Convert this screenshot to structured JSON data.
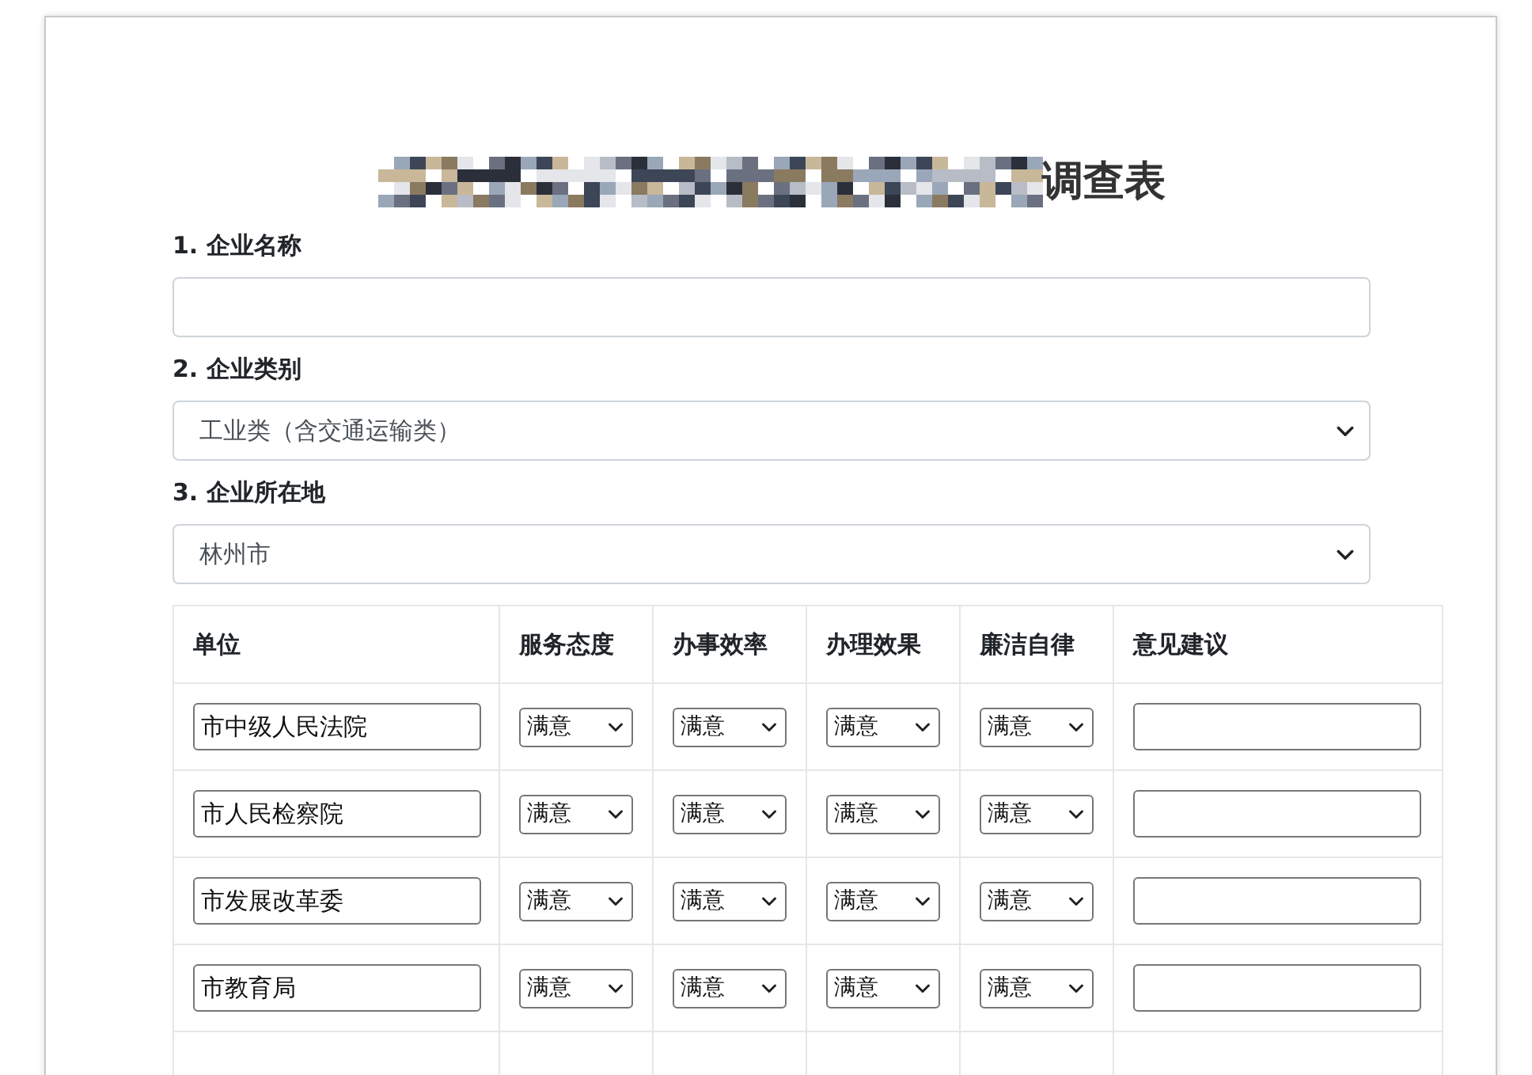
{
  "title": "调查表",
  "fields": [
    {
      "label": "1. 企业名称",
      "kind": "text"
    },
    {
      "label": "2. 企业类别",
      "kind": "select",
      "value": "工业类（含交通运输类）"
    },
    {
      "label": "3. 企业所在地",
      "kind": "select",
      "value": "林州市"
    }
  ],
  "table": {
    "columns": [
      "单位",
      "服务态度",
      "办事效率",
      "办理效果",
      "廉洁自律",
      "意见建议"
    ],
    "rows": [
      {
        "unit": "市中级人民法院",
        "ratings": [
          "满意",
          "满意",
          "满意",
          "满意"
        ]
      },
      {
        "unit": "市人民检察院",
        "ratings": [
          "满意",
          "满意",
          "满意",
          "满意"
        ]
      },
      {
        "unit": "市发展改革委",
        "ratings": [
          "满意",
          "满意",
          "满意",
          "满意"
        ]
      },
      {
        "unit": "市教育局",
        "ratings": [
          "满意",
          "满意",
          "满意",
          "满意"
        ]
      }
    ]
  }
}
